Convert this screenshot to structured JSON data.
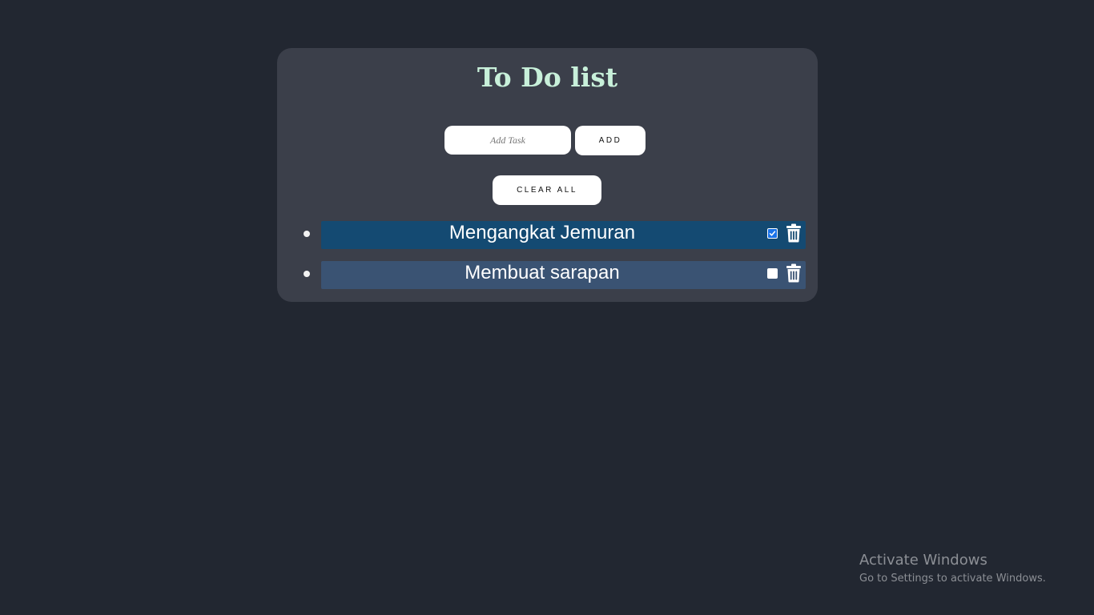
{
  "app": {
    "title": "To Do list"
  },
  "input": {
    "placeholder": "Add Task",
    "value": ""
  },
  "buttons": {
    "add_label": "ADD",
    "clear_all_label": "CLEAR ALL"
  },
  "tasks": [
    {
      "text": "Mengangkat Jemuran",
      "checked": true,
      "delete_icon": "trash-icon"
    },
    {
      "text": "Membuat sarapan",
      "checked": false,
      "delete_icon": "trash-icon"
    }
  ],
  "watermark": {
    "title": "Activate Windows",
    "subtitle": "Go to Settings to activate Windows."
  },
  "colors": {
    "background": "#222731",
    "card": "#3b3f4a",
    "title": "#c8f0da",
    "task_checked_bg": "#144a72",
    "task_unchecked_bg": "#3a5373",
    "checkbox_checked": "#1a73e8"
  }
}
